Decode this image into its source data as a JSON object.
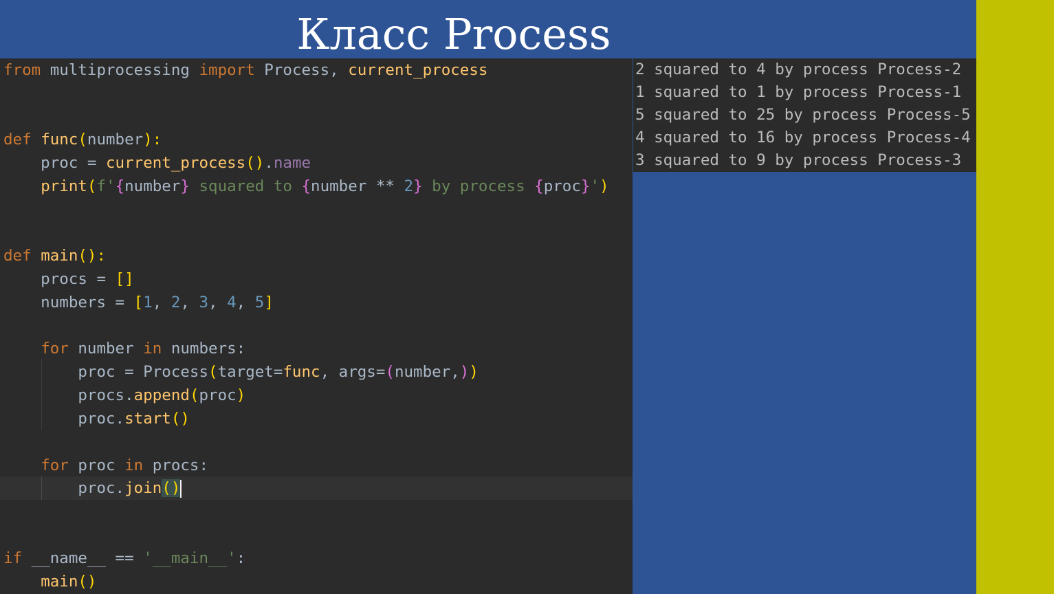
{
  "slide": {
    "title": "Класс Process"
  },
  "editor": {
    "lines": [
      [
        {
          "t": "from",
          "c": "kw"
        },
        {
          "t": " multiprocessing ",
          "c": ""
        },
        {
          "t": "import",
          "c": "kw"
        },
        {
          "t": " Process, ",
          "c": ""
        },
        {
          "t": "current_process",
          "c": "fn"
        }
      ],
      [],
      [],
      [
        {
          "t": "def",
          "c": "kw"
        },
        {
          "t": " ",
          "c": ""
        },
        {
          "t": "func",
          "c": "fn"
        },
        {
          "t": "(",
          "c": "par"
        },
        {
          "t": "number",
          "c": ""
        },
        {
          "t": "):",
          "c": "par"
        }
      ],
      [
        {
          "t": "    proc = ",
          "c": ""
        },
        {
          "t": "current_process",
          "c": "fn"
        },
        {
          "t": "()",
          "c": "par"
        },
        {
          "t": ".",
          "c": ""
        },
        {
          "t": "name",
          "c": "attr"
        }
      ],
      [
        {
          "t": "    ",
          "c": ""
        },
        {
          "t": "print",
          "c": "fn"
        },
        {
          "t": "(",
          "c": "par"
        },
        {
          "t": "f'",
          "c": "str"
        },
        {
          "t": "{",
          "c": "br"
        },
        {
          "t": "number",
          "c": ""
        },
        {
          "t": "}",
          "c": "br"
        },
        {
          "t": " squared to ",
          "c": "str"
        },
        {
          "t": "{",
          "c": "br"
        },
        {
          "t": "number ** ",
          "c": ""
        },
        {
          "t": "2",
          "c": "num"
        },
        {
          "t": "}",
          "c": "br"
        },
        {
          "t": " by process ",
          "c": "str"
        },
        {
          "t": "{",
          "c": "br"
        },
        {
          "t": "proc",
          "c": ""
        },
        {
          "t": "}",
          "c": "br"
        },
        {
          "t": "'",
          "c": "str"
        },
        {
          "t": ")",
          "c": "par"
        }
      ],
      [],
      [],
      [
        {
          "t": "def",
          "c": "kw"
        },
        {
          "t": " ",
          "c": ""
        },
        {
          "t": "main",
          "c": "fn"
        },
        {
          "t": "():",
          "c": "par"
        }
      ],
      [
        {
          "t": "    procs = ",
          "c": ""
        },
        {
          "t": "[]",
          "c": "par"
        }
      ],
      [
        {
          "t": "    numbers = ",
          "c": ""
        },
        {
          "t": "[",
          "c": "par"
        },
        {
          "t": "1",
          "c": "num"
        },
        {
          "t": ", ",
          "c": ""
        },
        {
          "t": "2",
          "c": "num"
        },
        {
          "t": ", ",
          "c": ""
        },
        {
          "t": "3",
          "c": "num"
        },
        {
          "t": ", ",
          "c": ""
        },
        {
          "t": "4",
          "c": "num"
        },
        {
          "t": ", ",
          "c": ""
        },
        {
          "t": "5",
          "c": "num"
        },
        {
          "t": "]",
          "c": "par"
        }
      ],
      [],
      [
        {
          "t": "    ",
          "c": ""
        },
        {
          "t": "for",
          "c": "kw"
        },
        {
          "t": " number ",
          "c": ""
        },
        {
          "t": "in",
          "c": "kw"
        },
        {
          "t": " numbers:",
          "c": ""
        }
      ],
      [
        {
          "t": "        proc = Process",
          "c": ""
        },
        {
          "t": "(",
          "c": "par"
        },
        {
          "t": "target=",
          "c": ""
        },
        {
          "t": "func",
          "c": "fn"
        },
        {
          "t": ", args=",
          "c": ""
        },
        {
          "t": "(",
          "c": "br"
        },
        {
          "t": "number,",
          "c": ""
        },
        {
          "t": ")",
          "c": "br"
        },
        {
          "t": ")",
          "c": "par"
        }
      ],
      [
        {
          "t": "        procs.",
          "c": ""
        },
        {
          "t": "append",
          "c": "fn"
        },
        {
          "t": "(",
          "c": "par"
        },
        {
          "t": "proc",
          "c": ""
        },
        {
          "t": ")",
          "c": "par"
        }
      ],
      [
        {
          "t": "        proc.",
          "c": ""
        },
        {
          "t": "start",
          "c": "fn"
        },
        {
          "t": "()",
          "c": "par"
        }
      ],
      [],
      [
        {
          "t": "    ",
          "c": ""
        },
        {
          "t": "for",
          "c": "kw"
        },
        {
          "t": " proc ",
          "c": ""
        },
        {
          "t": "in",
          "c": "kw"
        },
        {
          "t": " procs:",
          "c": ""
        }
      ],
      [
        {
          "t": "        proc.",
          "c": ""
        },
        {
          "t": "join",
          "c": "fn"
        },
        {
          "t": "()",
          "c": "cursor-pair"
        }
      ],
      [],
      [],
      [
        {
          "t": "if",
          "c": "kw"
        },
        {
          "t": " __name__ == ",
          "c": ""
        },
        {
          "t": "'__main__'",
          "c": "str"
        },
        {
          "t": ":",
          "c": ""
        }
      ],
      [
        {
          "t": "    ",
          "c": ""
        },
        {
          "t": "main",
          "c": "fn"
        },
        {
          "t": "()",
          "c": "par"
        }
      ]
    ]
  },
  "output": {
    "lines": [
      "2 squared to 4 by process Process-2",
      "1 squared to 1 by process Process-1",
      "5 squared to 25 by process Process-5",
      "4 squared to 16 by process Process-4",
      "3 squared to 9 by process Process-3"
    ]
  },
  "colors": {
    "slide_background": "#2e5496",
    "accent_bar": "#c1c102",
    "editor_background": "#2b2b2b",
    "keyword": "#cc7832",
    "function": "#ffc66d",
    "string": "#6a8759",
    "number": "#6897bb"
  }
}
